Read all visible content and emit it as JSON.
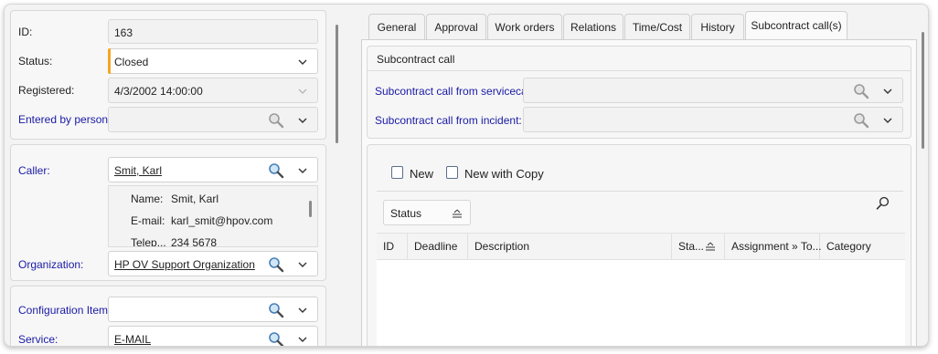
{
  "left": {
    "id": {
      "label": "ID:",
      "value": "163"
    },
    "status": {
      "label": "Status:",
      "value": "Closed"
    },
    "registered": {
      "label": "Registered:",
      "value": "4/3/2002 14:00:00"
    },
    "entered_by": {
      "label": "Entered by person:",
      "value": ""
    },
    "caller": {
      "label": "Caller:",
      "value": "Smit, Karl"
    },
    "caller_details": {
      "name_label": "Name:",
      "name_value": "Smit, Karl",
      "email_label": "E-mail:",
      "email_value": "karl_smit@hpov.com",
      "phone_label": "Telep...",
      "phone_value": "234 5678"
    },
    "organization": {
      "label": "Organization:",
      "value": "HP OV Support Organization"
    },
    "config_item": {
      "label": "Configuration Item:",
      "value": ""
    },
    "service": {
      "label": "Service:",
      "value": "E-MAIL"
    }
  },
  "tabs": [
    {
      "label": "General"
    },
    {
      "label": "Approval"
    },
    {
      "label": "Work orders"
    },
    {
      "label": "Relations"
    },
    {
      "label": "Time/Cost"
    },
    {
      "label": "History"
    },
    {
      "label": "Subcontract call(s)"
    }
  ],
  "subcontract": {
    "section_title": "Subcontract call",
    "from_servicecall_label": "Subcontract call from servicecall:",
    "from_incident_label": "Subcontract call from incident:"
  },
  "toolbar": {
    "new_label": "New",
    "new_with_copy_label": "New with Copy"
  },
  "grouping": {
    "status_label": "Status"
  },
  "table": {
    "columns": [
      "ID",
      "Deadline",
      "Description",
      "Sta...",
      "Assignment » To...",
      "Category"
    ]
  },
  "colors": {
    "accent_marker": "#f5a623",
    "link_label": "#1a1aa6"
  }
}
